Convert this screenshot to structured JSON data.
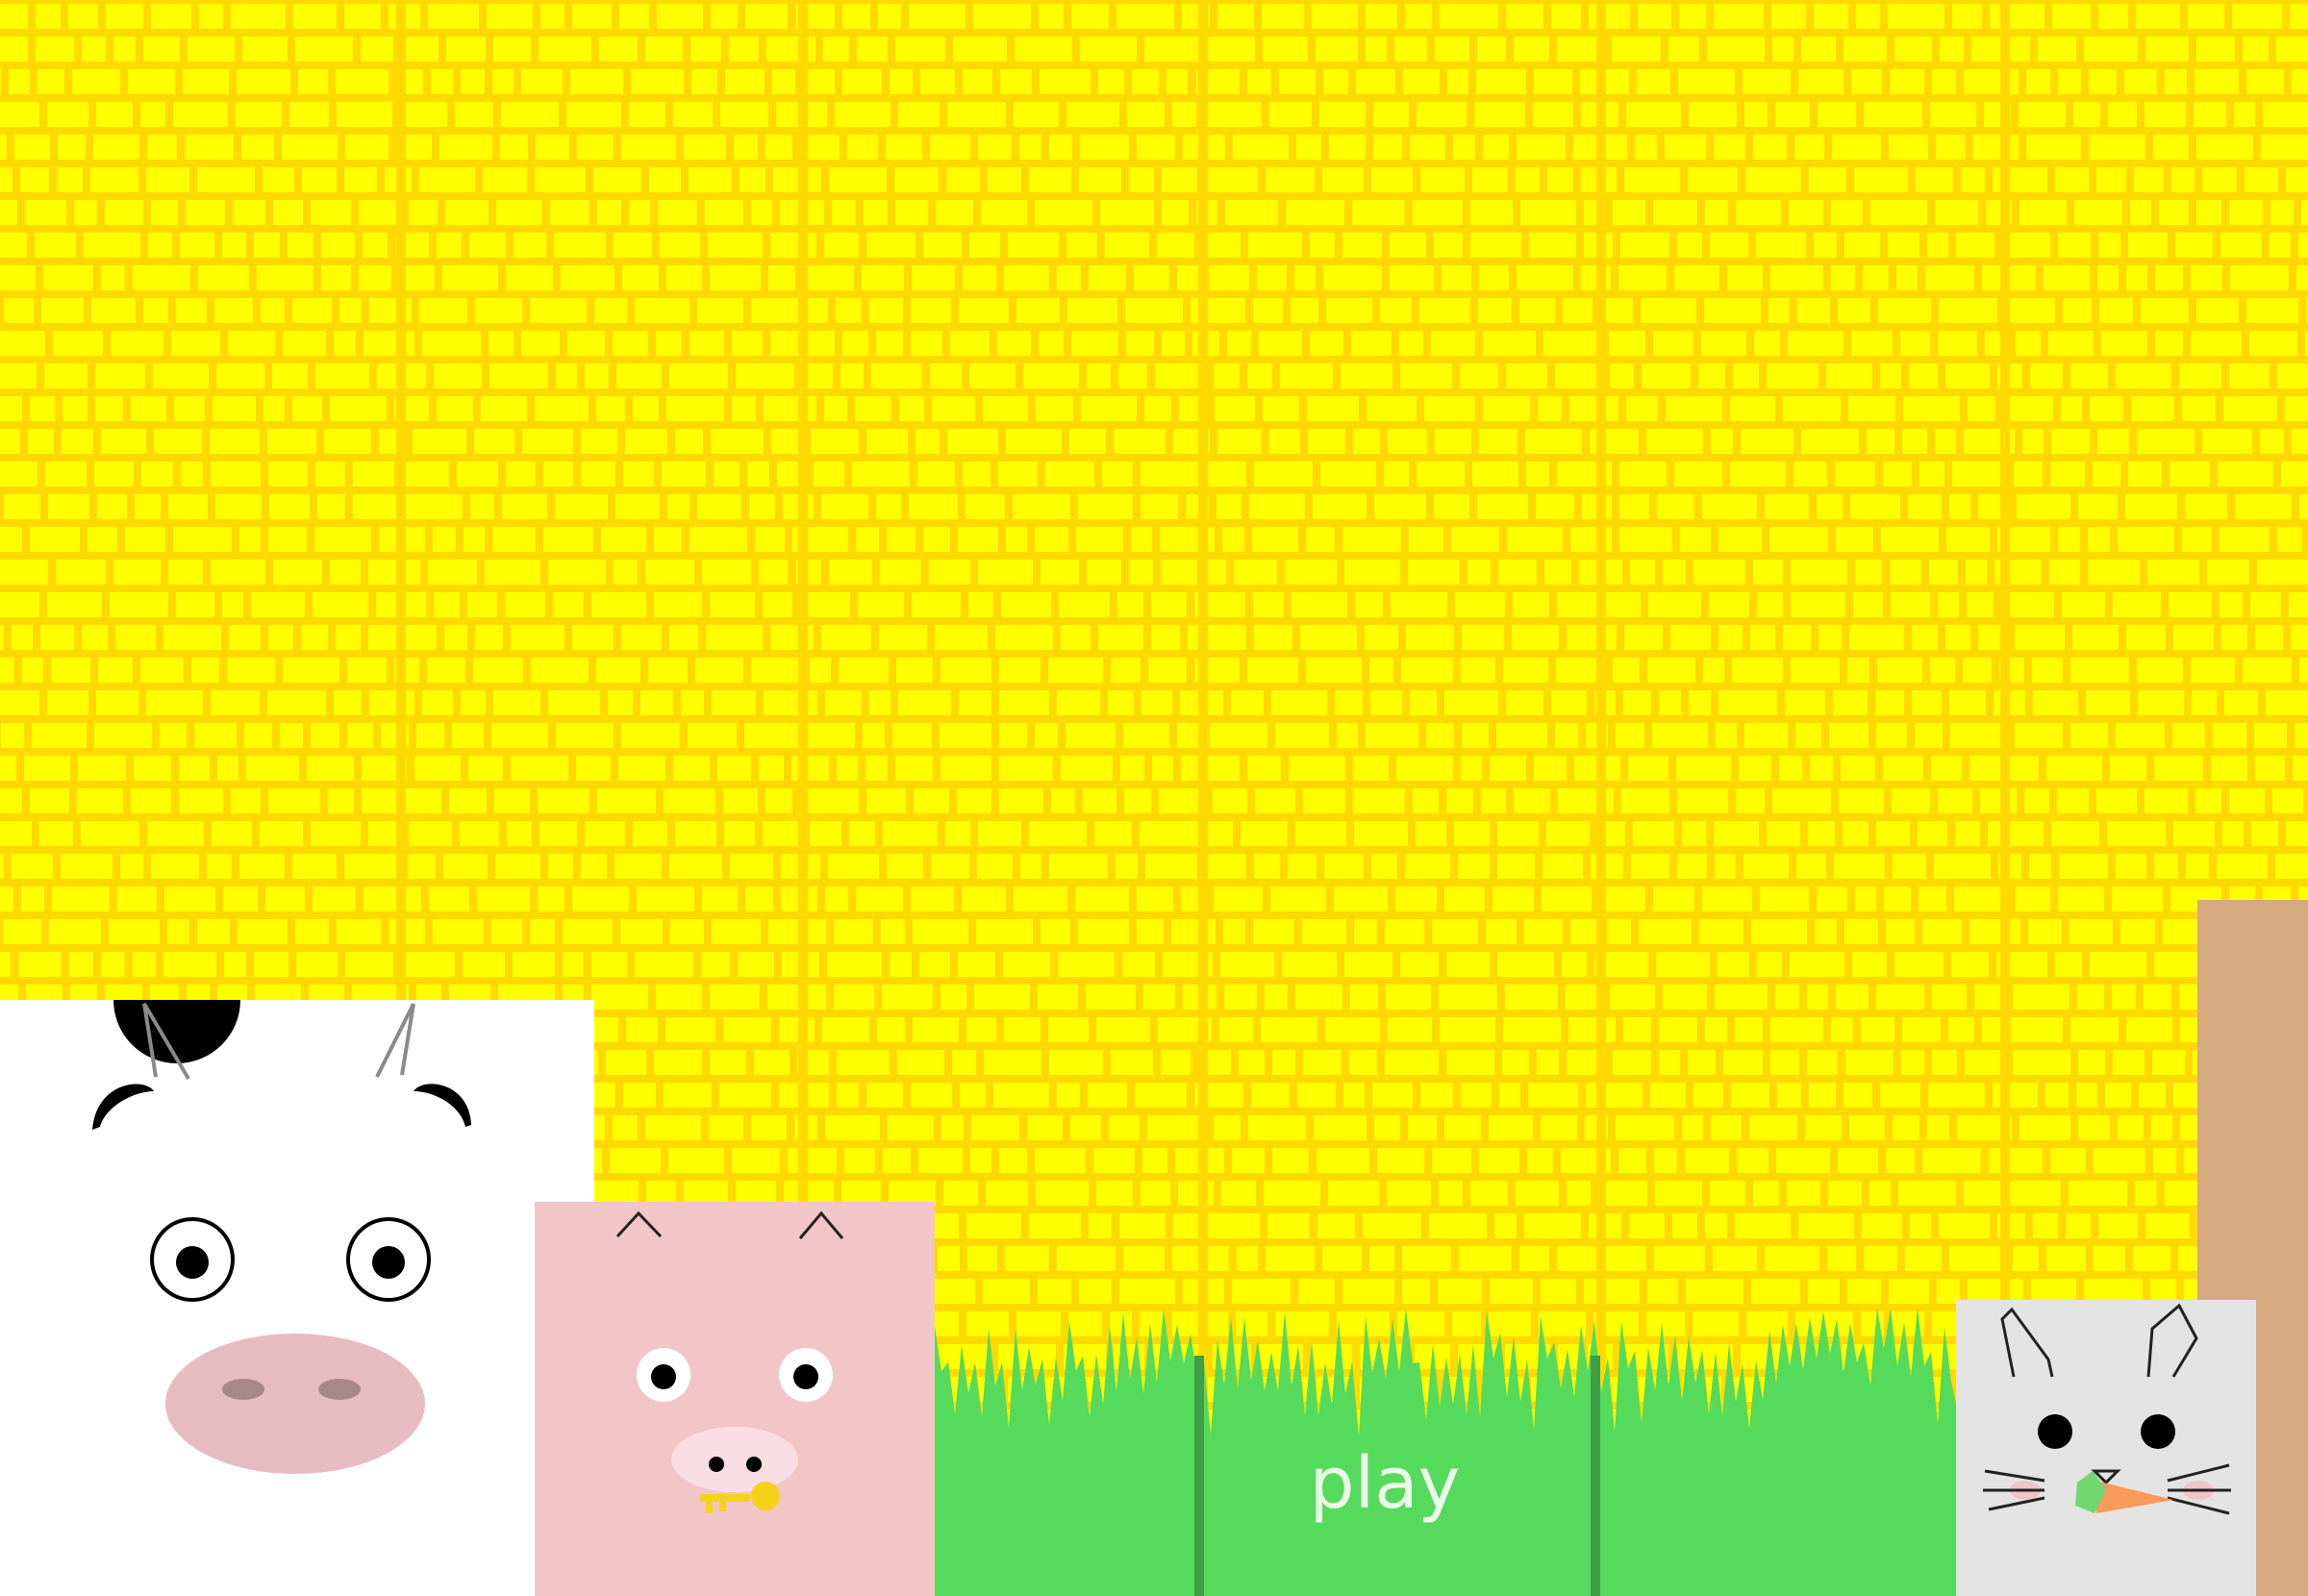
{
  "colors": {
    "wall": "#ffff00",
    "wall_lines": "#ffd900",
    "grass": "#55da5b",
    "grass_dark": "#3f9f45",
    "cow_face": "#ffffff",
    "pig_face": "#f2c6c6",
    "rabbit_face": "#e3e3e3",
    "box": "#d4aa7e",
    "play_text": "#eafbe8"
  },
  "play_button": {
    "label": "play"
  },
  "characters": {
    "cow": {
      "name": "cow",
      "icon": "cow-face-icon"
    },
    "pig": {
      "name": "pig",
      "icon": "pig-face-icon",
      "holding": "key-icon"
    },
    "rabbit": {
      "name": "rabbit",
      "icon": "rabbit-face-icon",
      "holding": "carrot-icon"
    }
  }
}
